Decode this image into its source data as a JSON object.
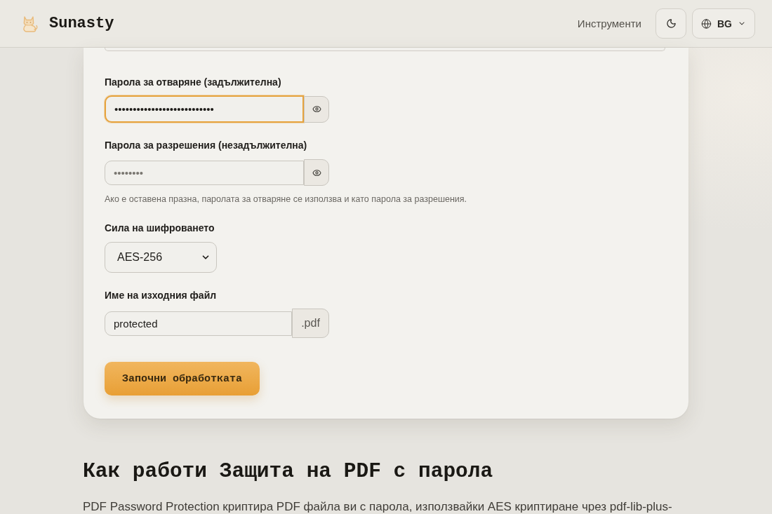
{
  "header": {
    "logo_text": "Sunasty",
    "nav_link": "Инструменти",
    "language": "BG"
  },
  "form": {
    "password_fields": [
      {
        "label": "Парола за отваряне (задължителна)",
        "value": "•••••••••••••••••••••••••••",
        "focused": true
      },
      {
        "label": "Парола за разрешения (незадължителна)",
        "placeholder": "••••••••",
        "focused": false
      }
    ],
    "hint": "Ако е оставена празна, паролата за отваряне се използва и като парола за разрешения.",
    "encryption": {
      "label": "Сила на шифроването",
      "value": "AES-256"
    },
    "output_name": {
      "label": "Име на изходния файл",
      "value": "protected",
      "suffix": ".pdf"
    },
    "submit_button": "Започни обработката"
  },
  "about": {
    "heading": "Как работи Защита на PDF с парола",
    "paragraph": "PDF Password Protection криптира PDF файла ви с парола, използвайки AES криптиране чрез pdf-lib-plus-"
  }
}
